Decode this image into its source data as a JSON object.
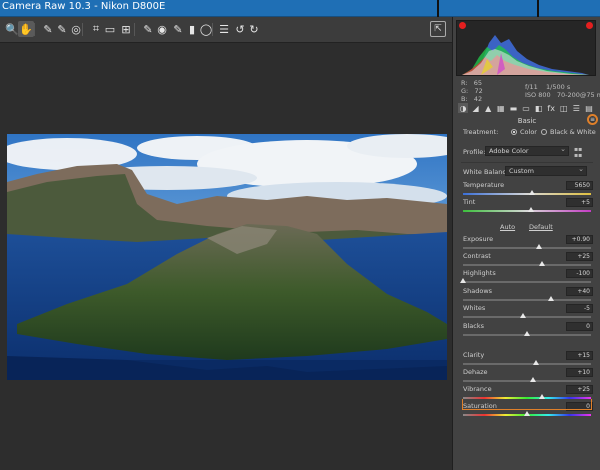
{
  "window": {
    "title": "Camera Raw 10.3  -  Nikon D800E"
  },
  "toolbar": {
    "tools": [
      {
        "name": "zoom-tool-icon",
        "glyph": "🔍"
      },
      {
        "name": "hand-tool-icon",
        "glyph": "✋"
      },
      {
        "name": "white-balance-tool-icon",
        "glyph": "✎"
      },
      {
        "name": "color-sampler-tool-icon",
        "glyph": "✎"
      },
      {
        "name": "targeted-adjustment-tool-icon",
        "glyph": "◎"
      },
      {
        "name": "crop-tool-icon",
        "glyph": "⌗"
      },
      {
        "name": "straighten-tool-icon",
        "glyph": "▭"
      },
      {
        "name": "transform-tool-icon",
        "glyph": "⊞"
      },
      {
        "name": "spot-removal-tool-icon",
        "glyph": "✎"
      },
      {
        "name": "red-eye-tool-icon",
        "glyph": "◉"
      },
      {
        "name": "adjustment-brush-icon",
        "glyph": "✎"
      },
      {
        "name": "graduated-filter-icon",
        "glyph": "▮"
      },
      {
        "name": "radial-filter-icon",
        "glyph": "◯"
      },
      {
        "name": "preferences-icon",
        "glyph": "☰"
      },
      {
        "name": "rotate-ccw-icon",
        "glyph": "↺"
      },
      {
        "name": "rotate-cw-icon",
        "glyph": "↻"
      }
    ],
    "export_glyph": "⇱"
  },
  "panel": {
    "readout": {
      "r_label": "R:",
      "r_value": "65",
      "g_label": "G:",
      "g_value": "72",
      "b_label": "B:",
      "b_value": "42",
      "aperture": "f/11",
      "shutter": "1/500 s",
      "iso": "ISO 800",
      "lens": "70-200@75 mm"
    },
    "section_title": "Basic",
    "menu_glyph": "≡",
    "treatment_label": "Treatment:",
    "treatment_options": [
      "Color",
      "Black & White"
    ],
    "profile_label": "Profile:",
    "profile_value": "Adobe Color",
    "white_balance_label": "White Balance:",
    "white_balance_value": "Custom",
    "auto_label": "Auto",
    "default_label": "Default",
    "sliders": [
      {
        "id": "temperature",
        "label": "Temperature",
        "value": "5650",
        "pos": 0.54
      },
      {
        "id": "tint",
        "label": "Tint",
        "value": "+5",
        "pos": 0.53
      },
      {
        "id": "exposure",
        "label": "Exposure",
        "value": "+0.90",
        "pos": 0.59
      },
      {
        "id": "contrast",
        "label": "Contrast",
        "value": "+25",
        "pos": 0.62
      },
      {
        "id": "highlights",
        "label": "Highlights",
        "value": "-100",
        "pos": 0.0
      },
      {
        "id": "shadows",
        "label": "Shadows",
        "value": "+40",
        "pos": 0.69
      },
      {
        "id": "whites",
        "label": "Whites",
        "value": "-5",
        "pos": 0.47
      },
      {
        "id": "blacks",
        "label": "Blacks",
        "value": "0",
        "pos": 0.5
      },
      {
        "id": "clarity",
        "label": "Clarity",
        "value": "+15",
        "pos": 0.57
      },
      {
        "id": "dehaze",
        "label": "Dehaze",
        "value": "+10",
        "pos": 0.55
      },
      {
        "id": "vibrance",
        "label": "Vibrance",
        "value": "+25",
        "pos": 0.62
      },
      {
        "id": "saturation",
        "label": "Saturation",
        "value": "0",
        "pos": 0.5
      }
    ],
    "tabs": [
      {
        "name": "basic-tab-icon",
        "glyph": "◑"
      },
      {
        "name": "tone-curve-tab-icon",
        "glyph": "◢"
      },
      {
        "name": "detail-tab-icon",
        "glyph": "▲"
      },
      {
        "name": "hsl-tab-icon",
        "glyph": "▦"
      },
      {
        "name": "split-toning-tab-icon",
        "glyph": "▬"
      },
      {
        "name": "lens-corrections-tab-icon",
        "glyph": "▭"
      },
      {
        "name": "transform-tab-icon",
        "glyph": "◧"
      },
      {
        "name": "effects-tab-icon",
        "glyph": "fx"
      },
      {
        "name": "camera-calibration-tab-icon",
        "glyph": "◫"
      },
      {
        "name": "presets-tab-icon",
        "glyph": "☰"
      },
      {
        "name": "snapshots-tab-icon",
        "glyph": "▤"
      }
    ]
  },
  "colors": {
    "titlebar": "#1f6fb5",
    "accent_orange": "#e0802a",
    "clip_warning": "#e41f1f"
  }
}
